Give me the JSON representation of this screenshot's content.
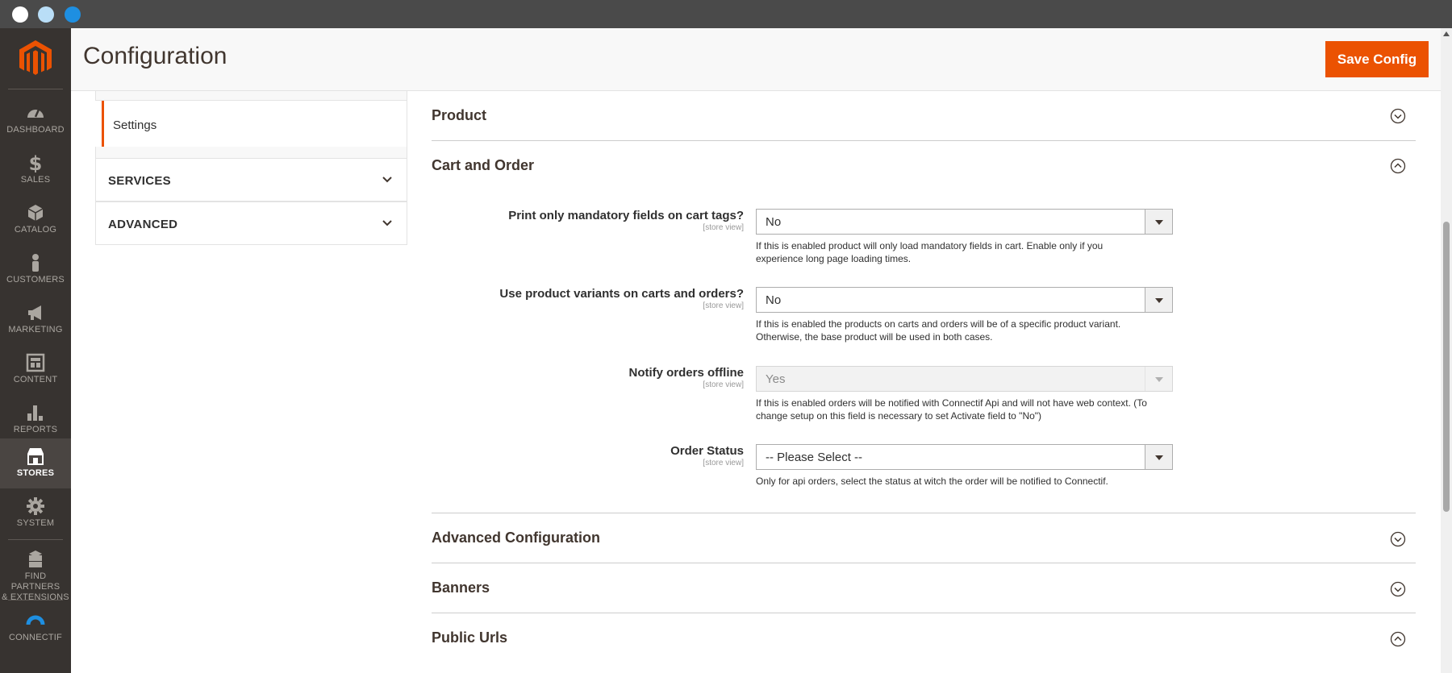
{
  "window": {
    "controls": [
      "close",
      "minimize",
      "maximize"
    ]
  },
  "sidebar": {
    "logo": "magento-logo-icon",
    "items": [
      {
        "label": "DASHBOARD",
        "icon": "dashboard-icon"
      },
      {
        "label": "SALES",
        "icon": "dollar-icon"
      },
      {
        "label": "CATALOG",
        "icon": "cube-icon"
      },
      {
        "label": "CUSTOMERS",
        "icon": "person-icon"
      },
      {
        "label": "MARKETING",
        "icon": "megaphone-icon"
      },
      {
        "label": "CONTENT",
        "icon": "layout-icon"
      },
      {
        "label": "REPORTS",
        "icon": "bar-chart-icon"
      },
      {
        "label": "STORES",
        "icon": "store-icon",
        "active": true
      },
      {
        "label": "SYSTEM",
        "icon": "gear-icon"
      },
      {
        "label_line1": "FIND PARTNERS",
        "label_line2": "& EXTENSIONS",
        "icon": "boxes-icon"
      },
      {
        "label": "CONNECTIF",
        "icon": "connectif-arc-icon"
      }
    ]
  },
  "header": {
    "title": "Configuration",
    "save_label": "Save Config"
  },
  "tabs": {
    "active_item": "Settings",
    "groups": [
      {
        "label": "SERVICES"
      },
      {
        "label": "ADVANCED"
      }
    ]
  },
  "sections": {
    "product": {
      "title": "Product",
      "state": "collapsed"
    },
    "cart_order": {
      "title": "Cart and Order",
      "state": "expanded",
      "fields": [
        {
          "label": "Print only mandatory fields on cart tags?",
          "scope": "[store view]",
          "value": "No",
          "note_line1": "If this is enabled product will only load mandatory fields in cart. Enable only if you",
          "note_line2": "experience long page loading times."
        },
        {
          "label": "Use product variants on carts and orders?",
          "scope": "[store view]",
          "value": "No",
          "note_line1": "If this is enabled the products on carts and orders will be of a specific product variant.",
          "note_line2": "Otherwise, the base product will be used in both cases."
        },
        {
          "label": "Notify orders offline",
          "scope": "[store view]",
          "value": "Yes",
          "disabled": true,
          "note_line1": "If this is enabled orders will be notified with Connectif Api and will not have web context. (To",
          "note_line2": "change setup on this field is necessary to set Activate field to \"No\")"
        },
        {
          "label": "Order Status",
          "scope": "[store view]",
          "value": "-- Please Select --",
          "note_line1": "Only for api orders, select the status at witch the order will be notified to Connectif."
        }
      ]
    },
    "advanced_config": {
      "title": "Advanced Configuration",
      "state": "collapsed"
    },
    "banners": {
      "title": "Banners",
      "state": "collapsed"
    },
    "public_urls": {
      "title": "Public Urls",
      "state": "expanded"
    }
  },
  "colors": {
    "accent": "#eb5202",
    "sidebar_bg": "#373330",
    "connectif_blue": "#1e8fe1"
  }
}
